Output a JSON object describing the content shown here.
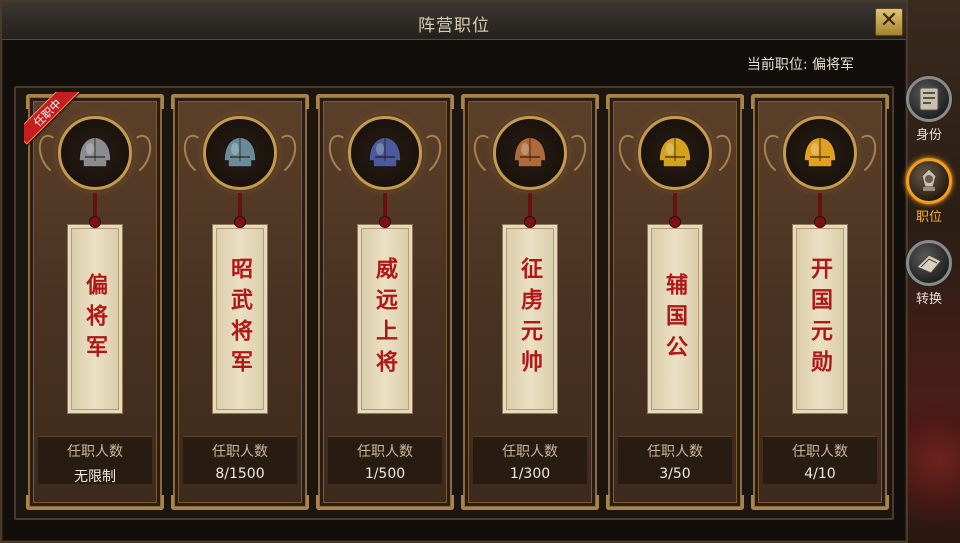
{
  "window": {
    "title": "阵营职位",
    "close_label": "✕"
  },
  "current_position": {
    "label": "当前职位:",
    "value": "偏将军"
  },
  "count_label": "任职人数",
  "badge": {
    "text": "任职中"
  },
  "ranks": [
    {
      "name": "偏将军",
      "count": "无限制",
      "helmet_color": "#8a8c90",
      "current": true
    },
    {
      "name": "昭武将军",
      "count": "8/1500",
      "helmet_color": "#6a8a98",
      "current": false
    },
    {
      "name": "威远上将",
      "count": "1/500",
      "helmet_color": "#4a5a9a",
      "current": false
    },
    {
      "name": "征虏元帅",
      "count": "1/300",
      "helmet_color": "#b06a3a",
      "current": false
    },
    {
      "name": "辅国公",
      "count": "3/50",
      "helmet_color": "#d4a21a",
      "current": false
    },
    {
      "name": "开国元勋",
      "count": "4/10",
      "helmet_color": "#e0a020",
      "current": false
    }
  ],
  "side_nav": [
    {
      "label": "身份",
      "icon": "identity-icon",
      "active": false
    },
    {
      "label": "职位",
      "icon": "position-icon",
      "active": true
    },
    {
      "label": "转换",
      "icon": "convert-icon",
      "active": false
    }
  ],
  "colors": {
    "rank_text": "#b01818",
    "active_nav": "#f0a020",
    "badge": "#c41f1f",
    "frame_gold": "#c49a52"
  }
}
